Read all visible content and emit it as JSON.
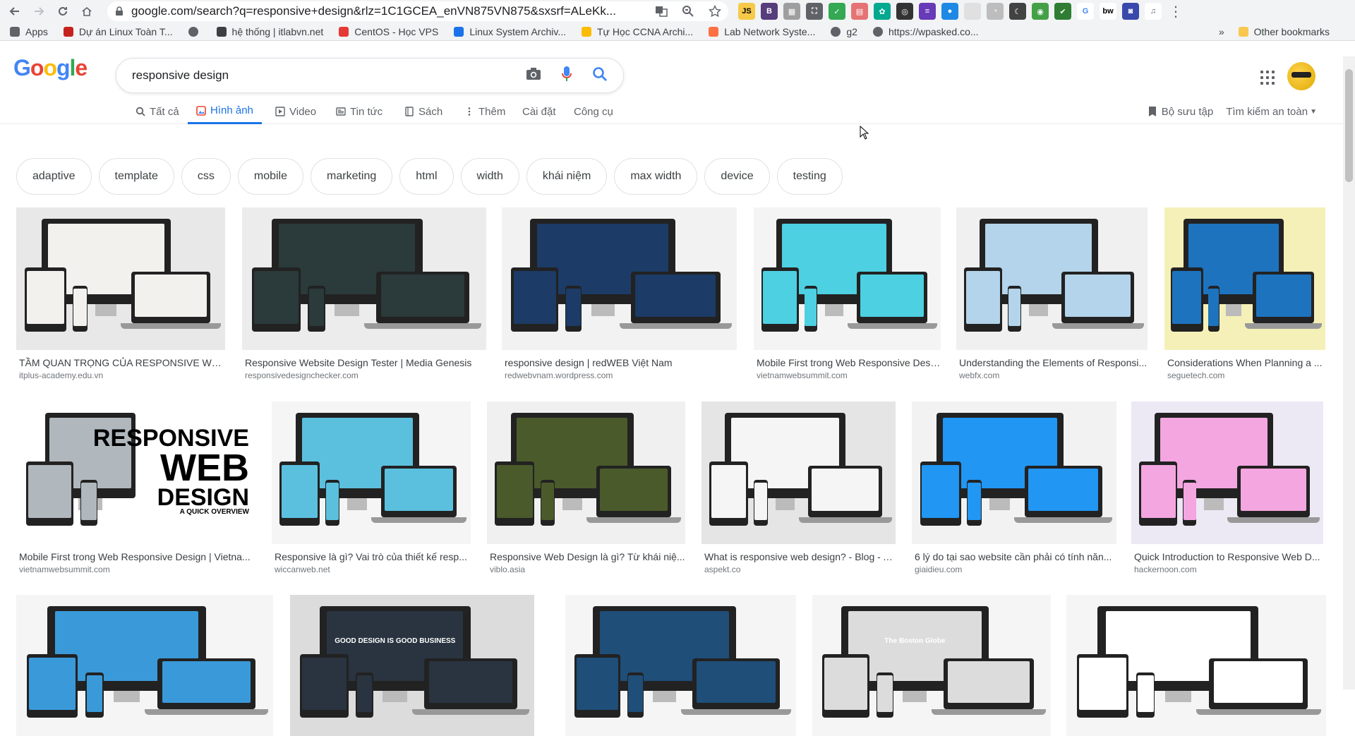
{
  "browser": {
    "url": "google.com/search?q=responsive+design&rlz=1C1GCEA_enVN875VN875&sxsrf=ALeKk...",
    "extensions": [
      {
        "name": "js-extension-icon",
        "label": "JS",
        "color": "#f7c948",
        "text_color": "#000"
      },
      {
        "name": "bootstrap-extension-icon",
        "label": "B",
        "color": "#563d7c"
      },
      {
        "name": "grid-extension-icon",
        "label": "▦",
        "color": "#9e9e9e"
      },
      {
        "name": "screenshot-extension-icon",
        "label": "⛶",
        "color": "#5f6368"
      },
      {
        "name": "check-extension-icon",
        "label": "✓",
        "color": "#34a853"
      },
      {
        "name": "calendar-extension-icon",
        "label": "▤",
        "color": "#e57373"
      },
      {
        "name": "leaf-extension-icon",
        "label": "✿",
        "color": "#00a98f"
      },
      {
        "name": "circle-extension-icon",
        "label": "◎",
        "color": "#333"
      },
      {
        "name": "lines-extension-icon",
        "label": "≡",
        "color": "#673ab7"
      },
      {
        "name": "drop-extension-icon",
        "label": "●",
        "color": "#1e88e5"
      },
      {
        "name": "blank-extension-icon",
        "label": "",
        "color": "#e0e0e0"
      },
      {
        "name": "timer-extension-icon",
        "label": "◔",
        "color": "#bdbdbd"
      },
      {
        "name": "moon-extension-icon",
        "label": "☾",
        "color": "#424242"
      },
      {
        "name": "globe-extension-icon",
        "label": "◉",
        "color": "#43a047"
      },
      {
        "name": "shield-extension-icon",
        "label": "✔",
        "color": "#2e7d32"
      },
      {
        "name": "google-extension-icon",
        "label": "G",
        "color": "#ffffff",
        "text_color": "#4285f4"
      },
      {
        "name": "bw-extension-icon",
        "label": "bw",
        "color": "#ffffff",
        "text_color": "#000"
      },
      {
        "name": "box-extension-icon",
        "label": "◙",
        "color": "#3949ab"
      },
      {
        "name": "playlist-extension-icon",
        "label": "♫",
        "color": "#ffffff",
        "text_color": "#5f6368"
      }
    ]
  },
  "bookmarks": {
    "items": [
      {
        "label": "Apps",
        "color": "#5f6368"
      },
      {
        "label": "Dự án Linux Toàn T...",
        "color": "#c5221f"
      },
      {
        "label": "",
        "color": "#5f6368"
      },
      {
        "label": "hệ thống | itlabvn.net",
        "color": "#3c4043"
      },
      {
        "label": "CentOS - Học VPS",
        "color": "#e53935"
      },
      {
        "label": "Linux System Archiv...",
        "color": "#1a73e8"
      },
      {
        "label": "Tự Học CCNA Archi...",
        "color": "#fbbc05"
      },
      {
        "label": "Lab Network Syste...",
        "color": "#ff7043"
      },
      {
        "label": "g2",
        "color": "#5f6368"
      },
      {
        "label": "https://wpasked.co...",
        "color": "#5f6368"
      }
    ],
    "more": "»",
    "other": "Other bookmarks"
  },
  "google": {
    "logo": [
      "G",
      "o",
      "o",
      "g",
      "l",
      "e"
    ],
    "query": "responsive design",
    "tabs": [
      {
        "label": "Tất cả",
        "icon": "search-icon"
      },
      {
        "label": "Hình ảnh",
        "icon": "image-icon",
        "active": true
      },
      {
        "label": "Video",
        "icon": "video-icon"
      },
      {
        "label": "Tin tức",
        "icon": "news-icon"
      },
      {
        "label": "Sách",
        "icon": "book-icon"
      },
      {
        "label": "Thêm",
        "icon": "more-icon"
      },
      {
        "label": "Cài đặt",
        "icon": ""
      },
      {
        "label": "Công cụ",
        "icon": ""
      }
    ],
    "collection": "Bộ sưu tập",
    "safe_search": "Tìm kiếm an toàn"
  },
  "chips": [
    "adaptive",
    "template",
    "css",
    "mobile",
    "marketing",
    "html",
    "width",
    "khái niệm",
    "max width",
    "device",
    "testing"
  ],
  "results": {
    "row1": [
      {
        "title": "TẦM QUAN TRỌNG CỦA RESPONSIVE WEB ...",
        "source": "itplus-academy.edu.vn",
        "bg": "#e8e8e8",
        "screen": "#f3f1ee"
      },
      {
        "title": "Responsive Website Design Tester | Media Genesis",
        "source": "responsivedesignchecker.com",
        "bg": "#ececec",
        "screen": "#2b3a3a"
      },
      {
        "title": "responsive design | redWEB Việt Nam",
        "source": "redwebvnam.wordpress.com",
        "bg": "#f2f2f2",
        "screen": "#1c3b66"
      },
      {
        "title": "Mobile First trong Web Responsive Desi...",
        "source": "vietnamwebsummit.com",
        "bg": "#f4f4f4",
        "screen": "#4dd0e1"
      },
      {
        "title": "Understanding the Elements of Responsi...",
        "source": "webfx.com",
        "bg": "#f0f0f0",
        "screen": "#b3d4ea"
      },
      {
        "title": "Considerations When Planning a ...",
        "source": "seguetech.com",
        "bg": "#f5f0b8",
        "screen": "#1e73be"
      }
    ],
    "row2": [
      {
        "title": "Mobile First trong Web Responsive Design | Vietna...",
        "source": "vietnamwebsummit.com",
        "bg": "#ffffff",
        "screen": "#b0b7bd",
        "headline": [
          "RESPONSIVE",
          "WEB",
          "DESIGN",
          "A QUICK OVERVIEW"
        ]
      },
      {
        "title": "Responsive là gì? Vai trò của thiết kế resp...",
        "source": "wiccanweb.net",
        "bg": "#f5f5f5",
        "screen": "#5bc0de"
      },
      {
        "title": "Responsive Web Design là gì? Từ khái niệ...",
        "source": "viblo.asia",
        "bg": "#f0f0f0",
        "screen": "#4a5a2a"
      },
      {
        "title": "What is responsive web design? - Blog - A...",
        "source": "aspekt.co",
        "bg": "#e5e5e5",
        "screen": "#f5f5f5"
      },
      {
        "title": "6 lý do tại sao website cần phải có tính năn...",
        "source": "giaidieu.com",
        "bg": "#f2f2f2",
        "screen": "#2196f3"
      },
      {
        "title": "Quick Introduction to Responsive Web D...",
        "source": "hackernoon.com",
        "bg": "#ece8f4",
        "screen": "#f3a6e0"
      }
    ],
    "row3": [
      {
        "bg": "#f5f5f5",
        "screen": "#3a9ad9"
      },
      {
        "bg": "#dcdcdc",
        "screen": "#2a3440",
        "headline": "GOOD DESIGN IS GOOD BUSINESS"
      },
      {
        "bg": "#f5f5f5",
        "screen": "#1f4e79"
      },
      {
        "bg": "#f5f5f5",
        "screen": "#dcdcdc",
        "headline": "The Boston Globe"
      },
      {
        "bg": "#f5f5f5",
        "screen": "#ffffff"
      }
    ]
  }
}
